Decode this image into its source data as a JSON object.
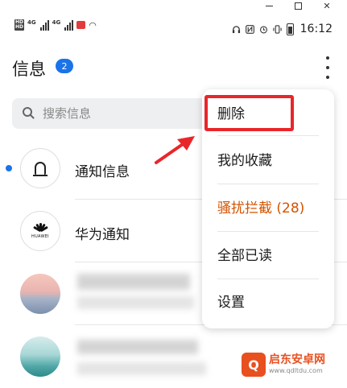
{
  "status_bar": {
    "network": "4G",
    "time": "16:12"
  },
  "header": {
    "title": "信息",
    "unread_count": "2"
  },
  "search": {
    "placeholder": "搜索信息"
  },
  "conversations": [
    {
      "name": "通知信息",
      "unread": true,
      "avatar": "bell-icon"
    },
    {
      "name": "华为通知",
      "unread": false,
      "avatar": "huawei-logo",
      "logo_text": "HUAWEI"
    },
    {
      "name": "",
      "unread": false,
      "avatar": "photo"
    },
    {
      "name": "",
      "unread": false,
      "avatar": "photo"
    }
  ],
  "menu": {
    "items": [
      {
        "label": "删除",
        "highlighted": true
      },
      {
        "label": "我的收藏"
      },
      {
        "label": "骚扰拦截 (28)",
        "color": "#d35400"
      },
      {
        "label": "全部已读"
      },
      {
        "label": "设置"
      }
    ]
  },
  "annotation": {
    "color": "#e8262a"
  },
  "watermark": {
    "title": "启东安卓网",
    "url": "www.qdltdu.com"
  },
  "colors": {
    "accent": "#1a73e8",
    "warning": "#d35400",
    "highlight": "#e8262a"
  }
}
